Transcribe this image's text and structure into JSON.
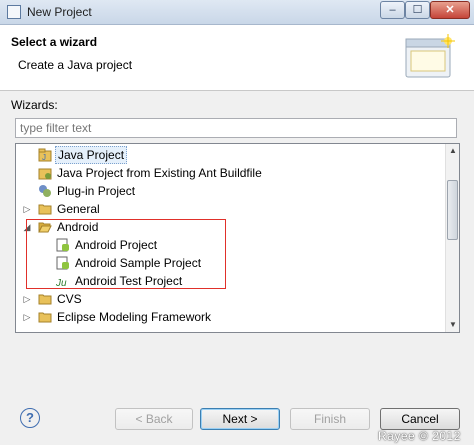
{
  "window": {
    "title": "New Project",
    "minimize_glyph": "–",
    "maximize_glyph": "☐",
    "close_glyph": "✕"
  },
  "header": {
    "title": "Select a wizard",
    "subtitle": "Create a Java project"
  },
  "wizards_label": "Wizards:",
  "filter": {
    "placeholder": "type filter text",
    "value": ""
  },
  "tree": {
    "items": [
      {
        "label": "Java Project",
        "icon": "java-project-icon",
        "selected": true
      },
      {
        "label": "Java Project from Existing Ant Buildfile",
        "icon": "java-ant-project-icon"
      },
      {
        "label": "Plug-in Project",
        "icon": "plugin-project-icon"
      },
      {
        "label": "General",
        "icon": "folder-icon",
        "expander": "▷"
      },
      {
        "label": "Android",
        "icon": "folder-open-icon",
        "expander": "◢"
      },
      {
        "label": "Android Project",
        "icon": "android-project-icon"
      },
      {
        "label": "Android Sample Project",
        "icon": "android-sample-project-icon"
      },
      {
        "label": "Android Test Project",
        "icon": "android-test-project-icon"
      },
      {
        "label": "CVS",
        "icon": "folder-icon",
        "expander": "▷"
      },
      {
        "label": "Eclipse Modeling Framework",
        "icon": "folder-icon",
        "expander": "▷"
      }
    ],
    "scroll_up_glyph": "▲",
    "scroll_down_glyph": "▼"
  },
  "buttons": {
    "help_glyph": "?",
    "back": "< Back",
    "next": "Next >",
    "finish": "Finish",
    "cancel": "Cancel"
  },
  "watermark": "Rayee © 2012",
  "colors": {
    "highlight_box": "#e0302a",
    "folder": "#e8c15a",
    "java_blue": "#3f6db0"
  }
}
